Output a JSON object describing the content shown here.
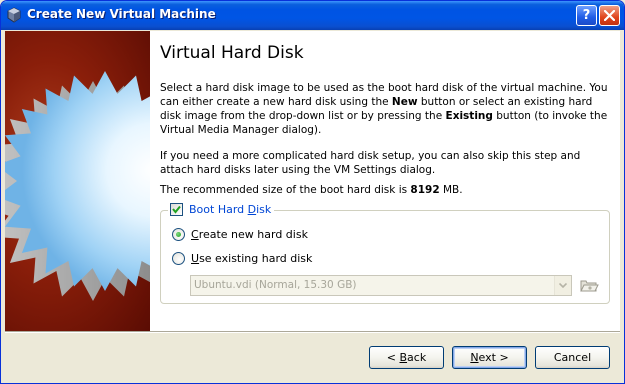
{
  "window": {
    "title": "Create New Virtual Machine",
    "help_label": "?",
    "close_label": "×"
  },
  "page": {
    "title": "Virtual Hard Disk",
    "para1": {
      "t1": "Select a hard disk image to be used as the boot hard disk of the virtual machine. You can either create a new hard disk using the ",
      "b1": "New",
      "t2": " button or select an existing hard disk image from the drop-down list or by pressing the ",
      "b2": "Existing",
      "t3": " button (to invoke the Virtual Media Manager dialog)."
    },
    "para2": "If you need a more complicated hard disk setup, you can also skip this step and attach hard disks later using the VM Settings dialog.",
    "para3": {
      "t1": "The recommended size of the boot hard disk is ",
      "size": "8192",
      "t2": " MB."
    }
  },
  "boot_disk": {
    "label_pre": "Boot Hard ",
    "label_ul": "D",
    "label_post": "isk",
    "checked": true,
    "options": [
      {
        "ul": "C",
        "rest": "reate new hard disk",
        "selected": true
      },
      {
        "ul": "U",
        "rest": "se existing hard disk",
        "selected": false
      }
    ],
    "combo_value": "Ubuntu.vdi (Normal, 15.30 GB)"
  },
  "buttons": {
    "back": {
      "pre": "< ",
      "ul": "B",
      "post": "ack"
    },
    "next": {
      "pre": "",
      "ul": "N",
      "post": "ext >"
    },
    "cancel": "Cancel"
  },
  "colors": {
    "titlebar": "#0054e3",
    "side_panel": "#8a1e0a",
    "group_label": "#0046d5",
    "radio_dot": "#21a121"
  }
}
